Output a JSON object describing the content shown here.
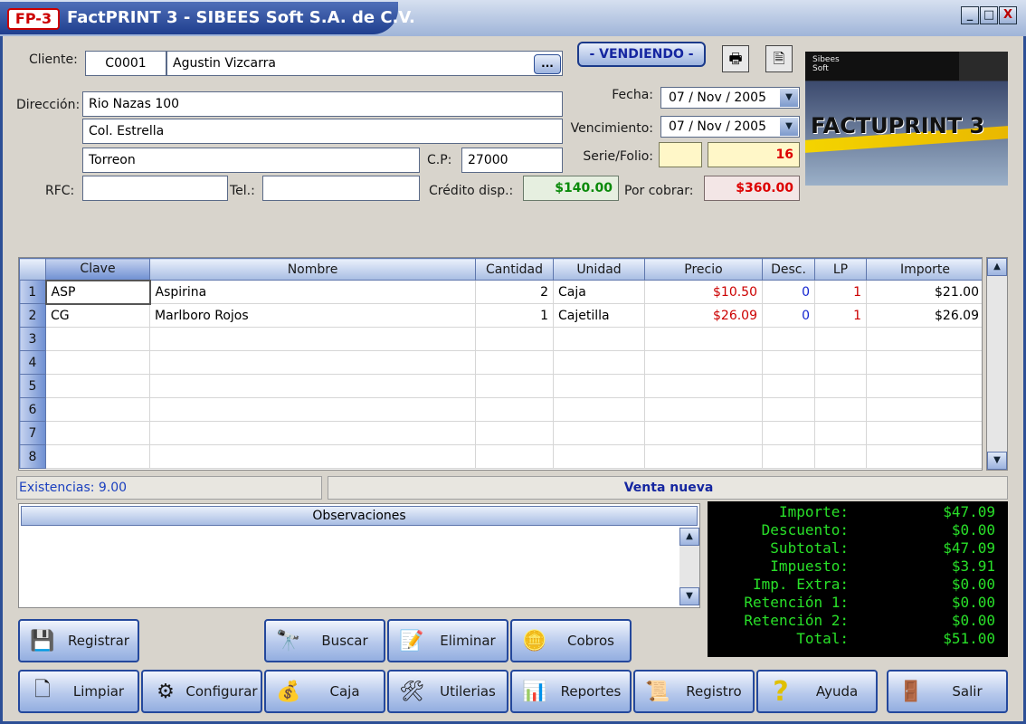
{
  "window": {
    "logo": "FP-3",
    "title": "FactPRINT 3 - SIBEES Soft S.A. de C.V.",
    "min": "_",
    "max": "□",
    "close": "X"
  },
  "client": {
    "label": "Cliente:",
    "code": "C0001",
    "name": "Agustin Vizcarra",
    "browse": "...",
    "address_label": "Dirección:",
    "addr1": "Rio Nazas 100",
    "addr2": "Col. Estrella",
    "city": "Torreon",
    "cp_label": "C.P:",
    "cp": "27000",
    "rfc_label": "RFC:",
    "rfc": "",
    "tel_label": "Tel.:",
    "tel": "",
    "credit_label": "Crédito disp.:",
    "credit": "$140.00",
    "due_label": "Por cobrar:",
    "due": "$360.00"
  },
  "mode": "- VENDIENDO -",
  "dates": {
    "fecha_label": "Fecha:",
    "fecha": "07 / Nov / 2005",
    "venc_label": "Vencimiento:",
    "venc": "07 / Nov / 2005",
    "serie_label": "Serie/Folio:",
    "serie": "",
    "folio": "16"
  },
  "brand": {
    "company_line1": "Sibees",
    "company_line2": "Soft",
    "product": "FACTUPRINT 3"
  },
  "grid": {
    "columns": [
      "Clave",
      "Nombre",
      "Cantidad",
      "Unidad",
      "Precio",
      "Desc.",
      "LP",
      "Importe"
    ],
    "rows": [
      {
        "n": "1",
        "clave": "ASP",
        "nombre": "Aspirina",
        "cantidad": "2",
        "unidad": "Caja",
        "precio": "$10.50",
        "desc": "0",
        "lp": "1",
        "importe": "$21.00"
      },
      {
        "n": "2",
        "clave": "CG",
        "nombre": "Marlboro Rojos",
        "cantidad": "1",
        "unidad": "Cajetilla",
        "precio": "$26.09",
        "desc": "0",
        "lp": "1",
        "importe": "$26.09"
      },
      {
        "n": "3"
      },
      {
        "n": "4"
      },
      {
        "n": "5"
      },
      {
        "n": "6"
      },
      {
        "n": "7"
      },
      {
        "n": "8"
      }
    ]
  },
  "status": {
    "stock": "Existencias: 9.00",
    "message": "Venta nueva"
  },
  "observaciones": {
    "title": "Observaciones",
    "text": ""
  },
  "totals": [
    {
      "label": "Importe:",
      "value": "$47.09"
    },
    {
      "label": "Descuento:",
      "value": "$0.00"
    },
    {
      "label": "Subtotal:",
      "value": "$47.09"
    },
    {
      "label": "Impuesto:",
      "value": "$3.91"
    },
    {
      "label": "Imp. Extra:",
      "value": "$0.00"
    },
    {
      "label": "Retención 1:",
      "value": "$0.00"
    },
    {
      "label": "Retención 2:",
      "value": "$0.00"
    },
    {
      "label": "Total:",
      "value": "$51.00"
    }
  ],
  "buttons": {
    "registrar": "Registrar",
    "buscar": "Buscar",
    "eliminar": "Eliminar",
    "cobros": "Cobros",
    "limpiar": "Limpiar",
    "configurar": "Configurar",
    "caja": "Caja",
    "utilerias": "Utilerias",
    "reportes": "Reportes",
    "registro": "Registro",
    "ayuda": "Ayuda",
    "salir": "Salir"
  },
  "colors": {
    "accent": "#2d4f96",
    "green_total": "#29e029",
    "price_red": "#cc0000"
  }
}
